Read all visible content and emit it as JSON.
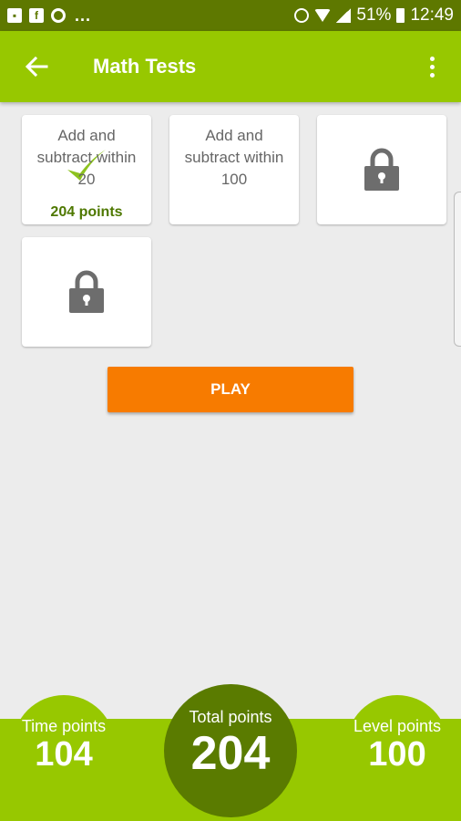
{
  "status_bar": {
    "battery": "51%",
    "time": "12:49",
    "overflow": "..."
  },
  "app_bar": {
    "title": "Math Tests"
  },
  "cards": [
    {
      "title": "Add and subtract within 20",
      "points": "204 points",
      "completed": true,
      "locked": false
    },
    {
      "title": "Add and subtract within 100",
      "points": "",
      "completed": false,
      "locked": false
    },
    {
      "title": "",
      "points": "",
      "completed": false,
      "locked": true
    },
    {
      "title": "",
      "points": "",
      "completed": false,
      "locked": true
    }
  ],
  "play_button": {
    "label": "PLAY"
  },
  "footer": {
    "time_points": {
      "label": "Time points",
      "value": "104"
    },
    "total_points": {
      "label": "Total points",
      "value": "204"
    },
    "level_points": {
      "label": "Level points",
      "value": "100"
    }
  },
  "colors": {
    "app_bar": "#97c800",
    "status_bar": "#5e7800",
    "play_button": "#f77b00",
    "total_circle": "#5a7b00",
    "points_text": "#4e7800",
    "lock": "#6d6d6d"
  }
}
